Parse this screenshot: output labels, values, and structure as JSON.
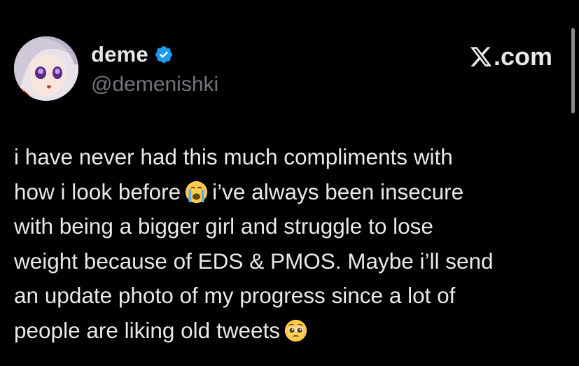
{
  "author": {
    "display_name": "deme",
    "handle": "@demenishki",
    "verified_icon": "verified-badge-icon",
    "avatar": "anime-avatar"
  },
  "brand": {
    "icon": "x-logo-icon",
    "suffix": ".com"
  },
  "tweet": {
    "line1": "i have never had this much compliments with",
    "line2a": "how i look before",
    "emoji1": "loudly-crying-face-emoji",
    "line2b": "i’ve always been insecure",
    "line3": "with being a bigger girl and struggle to lose",
    "line4": "weight because of EDS & PMOS. Maybe i’ll send",
    "line5": "an update photo of my progress since a lot of",
    "line6a": "people are liking old tweets",
    "emoji2": "pleading-face-emoji"
  },
  "colors": {
    "background": "#000000",
    "text": "#e7e9ea",
    "secondary": "#71767b",
    "verified": "#1d9bf0"
  }
}
